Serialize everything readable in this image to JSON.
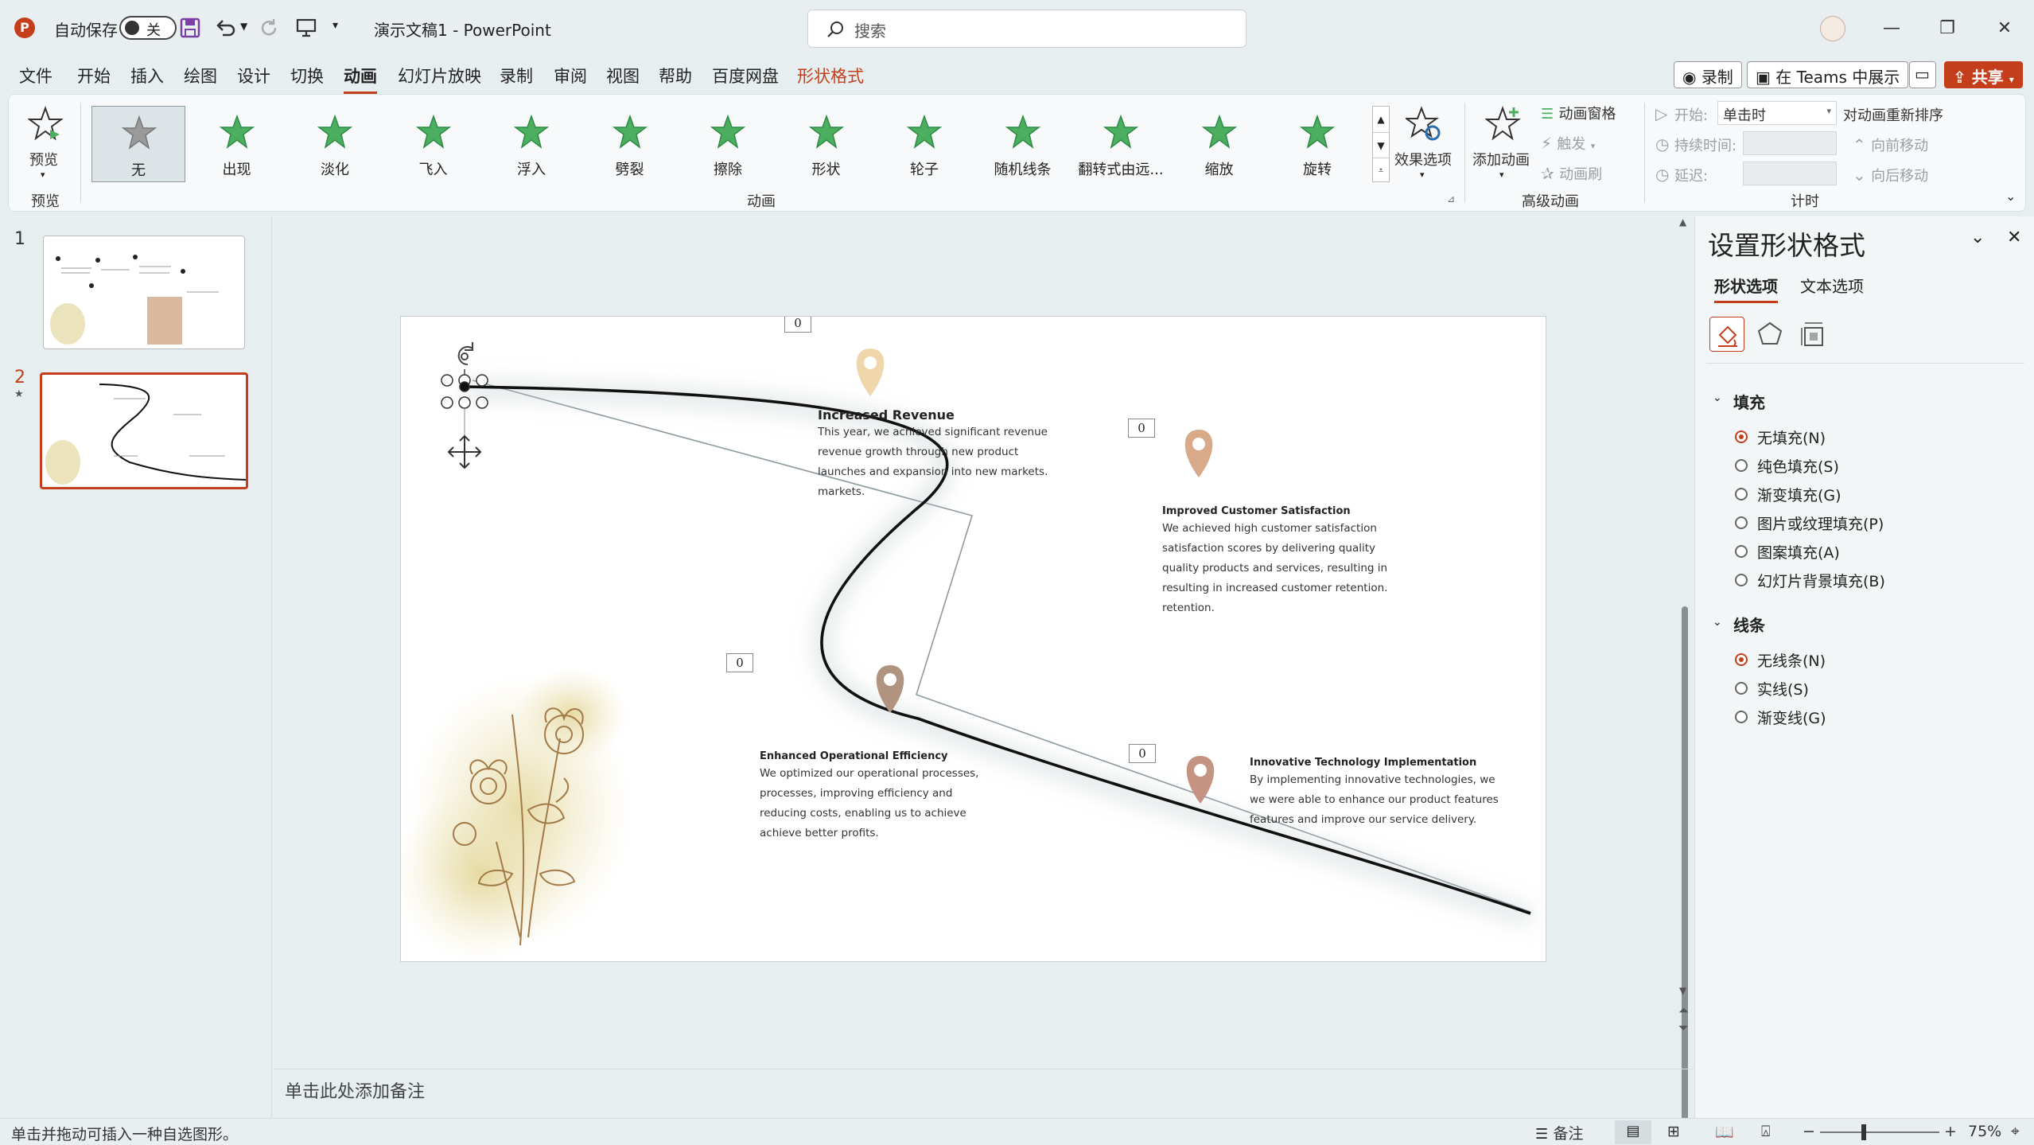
{
  "titlebar": {
    "autosave_label": "自动保存",
    "autosave_state": "关",
    "doc_title": "演示文稿1  -  PowerPoint",
    "search_placeholder": "搜索"
  },
  "menu": {
    "tabs": [
      "文件",
      "开始",
      "插入",
      "绘图",
      "设计",
      "切换",
      "动画",
      "幻灯片放映",
      "录制",
      "审阅",
      "视图",
      "帮助",
      "百度网盘",
      "形状格式"
    ],
    "record_label": "录制",
    "teams_label": "在 Teams 中展示",
    "share_label": "共享"
  },
  "ribbon": {
    "preview_label": "预览",
    "preview_group": "预览",
    "animations": [
      "无",
      "出现",
      "淡化",
      "飞入",
      "浮入",
      "劈裂",
      "擦除",
      "形状",
      "轮子",
      "随机线条",
      "翻转式由远...",
      "缩放",
      "旋转"
    ],
    "effect_options": "效果选项",
    "animation_group": "动画",
    "add_animation": "添加动画",
    "animation_pane": "动画窗格",
    "trigger": "触发",
    "painter": "动画刷",
    "advanced_group": "高级动画",
    "start_label": "开始:",
    "start_value": "单击时",
    "duration_label": "持续时间:",
    "delay_label": "延迟:",
    "reorder_label": "对动画重新排序",
    "move_earlier": "向前移动",
    "move_later": "向后移动",
    "timing_group": "计时"
  },
  "slides": [
    {
      "number": "1"
    },
    {
      "number": "2",
      "star": "★"
    }
  ],
  "slide": {
    "tag": "0",
    "blocks": [
      {
        "title": "Increased Revenue",
        "body": "This year, we achieved significant revenue\nrevenue growth through new product\nlaunches and expansion into new markets.\nmarkets."
      },
      {
        "title": "Improved Customer Satisfaction",
        "body": "We achieved high customer satisfaction\nsatisfaction scores by delivering quality\nquality products and services, resulting in\nresulting in increased customer retention.\nretention."
      },
      {
        "title": "Enhanced Operational Efficiency",
        "body": "We optimized our operational processes,\nprocesses, improving efficiency and\nreducing costs, enabling us to achieve\nachieve better profits."
      },
      {
        "title": "Innovative Technology Implementation",
        "body": "By implementing innovative technologies, we\nwe were able to enhance our product features\nfeatures and improve our service delivery."
      }
    ]
  },
  "notes_placeholder": "单击此处添加备注",
  "status": {
    "hint": "单击并拖动可插入一种自选图形。",
    "notes": "备注",
    "zoom": "75%"
  },
  "pane": {
    "title": "设置形状格式",
    "tab_shape": "形状选项",
    "tab_text": "文本选项",
    "fill_section": "填充",
    "fill_options": [
      "无填充(N)",
      "纯色填充(S)",
      "渐变填充(G)",
      "图片或纹理填充(P)",
      "图案填充(A)",
      "幻灯片背景填充(B)"
    ],
    "line_section": "线条",
    "line_options": [
      "无线条(N)",
      "实线(S)",
      "渐变线(G)"
    ]
  },
  "colors": {
    "accent": "#c43e1c",
    "star_green": "#4caf60",
    "pin_light": "#efd7ab",
    "pin_brown": "#b48e74"
  }
}
